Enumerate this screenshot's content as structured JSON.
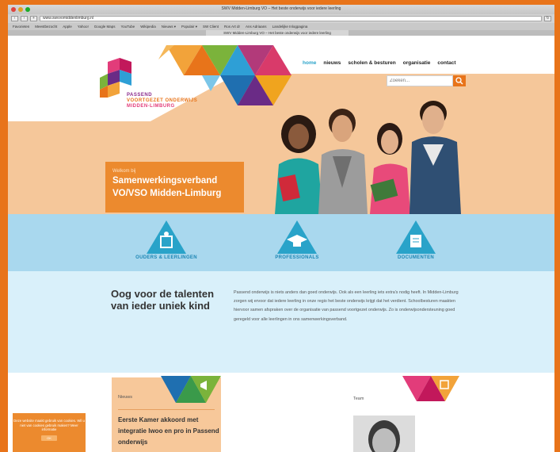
{
  "browser": {
    "window_title": "SWV Midden-Limburg VO – Het beste onderwijs voor iedere leerling",
    "url": "www.swvvomiddenlimburg.nl",
    "bookmarks": [
      "Favorieten",
      "Meestbezocht",
      "Apple",
      "Yahoo!",
      "Google Maps",
      "YouTube",
      "Wikipedia",
      "Nieuws ▾",
      "Populair ▾",
      "SW Client",
      "Ros Art dr",
      "Ans Adriaans",
      "Landelijke Inlogpagina"
    ],
    "tab_title": "SWV Midden-Limburg VO – Het beste onderwijs voor iedere leerling"
  },
  "logo": {
    "line1": "PASSEND",
    "line2": "VOORTGEZET ONDERWIJS",
    "line3": "MIDDEN-LIMBURG"
  },
  "nav": {
    "items": [
      {
        "label": "home",
        "active": true
      },
      {
        "label": "nieuws",
        "active": false
      },
      {
        "label": "scholen & besturen",
        "active": false
      },
      {
        "label": "organisatie",
        "active": false
      },
      {
        "label": "contact",
        "active": false
      }
    ]
  },
  "search": {
    "placeholder": "Zoeken...",
    "icon": "search-icon"
  },
  "hero": {
    "welcome_small": "Welkom bij",
    "welcome_line1": "Samenwerkingsverband",
    "welcome_line2": "VO/VSO Midden-Limburg"
  },
  "features": [
    {
      "label": "OUDERS & LEERLINGEN",
      "icon": "family-icon"
    },
    {
      "label": "PROFESSIONALS",
      "icon": "graduation-cap-icon"
    },
    {
      "label": "DOCUMENTEN",
      "icon": "document-icon"
    }
  ],
  "intro": {
    "title_line1": "Oog voor de talenten",
    "title_line2": "van ieder uniek kind",
    "text": "Passend onderwijs is niets anders dan goed onderwijs. Ook als een leerling iets extra's nodig heeft. In Midden-Limburg zorgen wij ervoor dat iedere leerling in onze regio het beste onderwijs krijgt dat het verdient. Schoolbesturen maakten hiervoor samen afspraken over de organisatie van passend voortgezet onderwijs. Zo is onderwijsondersteuning goed geregeld voor alle leerlingen in ons samenwerkingsverband."
  },
  "sidebox": {
    "text": "Deze website maakt gebruik van cookies. Wil u niet van cookies gebruik maken? Meer informatie",
    "button": "OK"
  },
  "news": {
    "heading": "Nieuws",
    "title": "Eerste Kamer akkoord met integratie lwoo en pro in Passend onderwijs"
  },
  "team": {
    "heading": "Team"
  },
  "colors": {
    "orange": "#e8741a",
    "peach": "#f5c79a",
    "blue": "#29a3c9",
    "lightblue": "#d9f0fa"
  }
}
